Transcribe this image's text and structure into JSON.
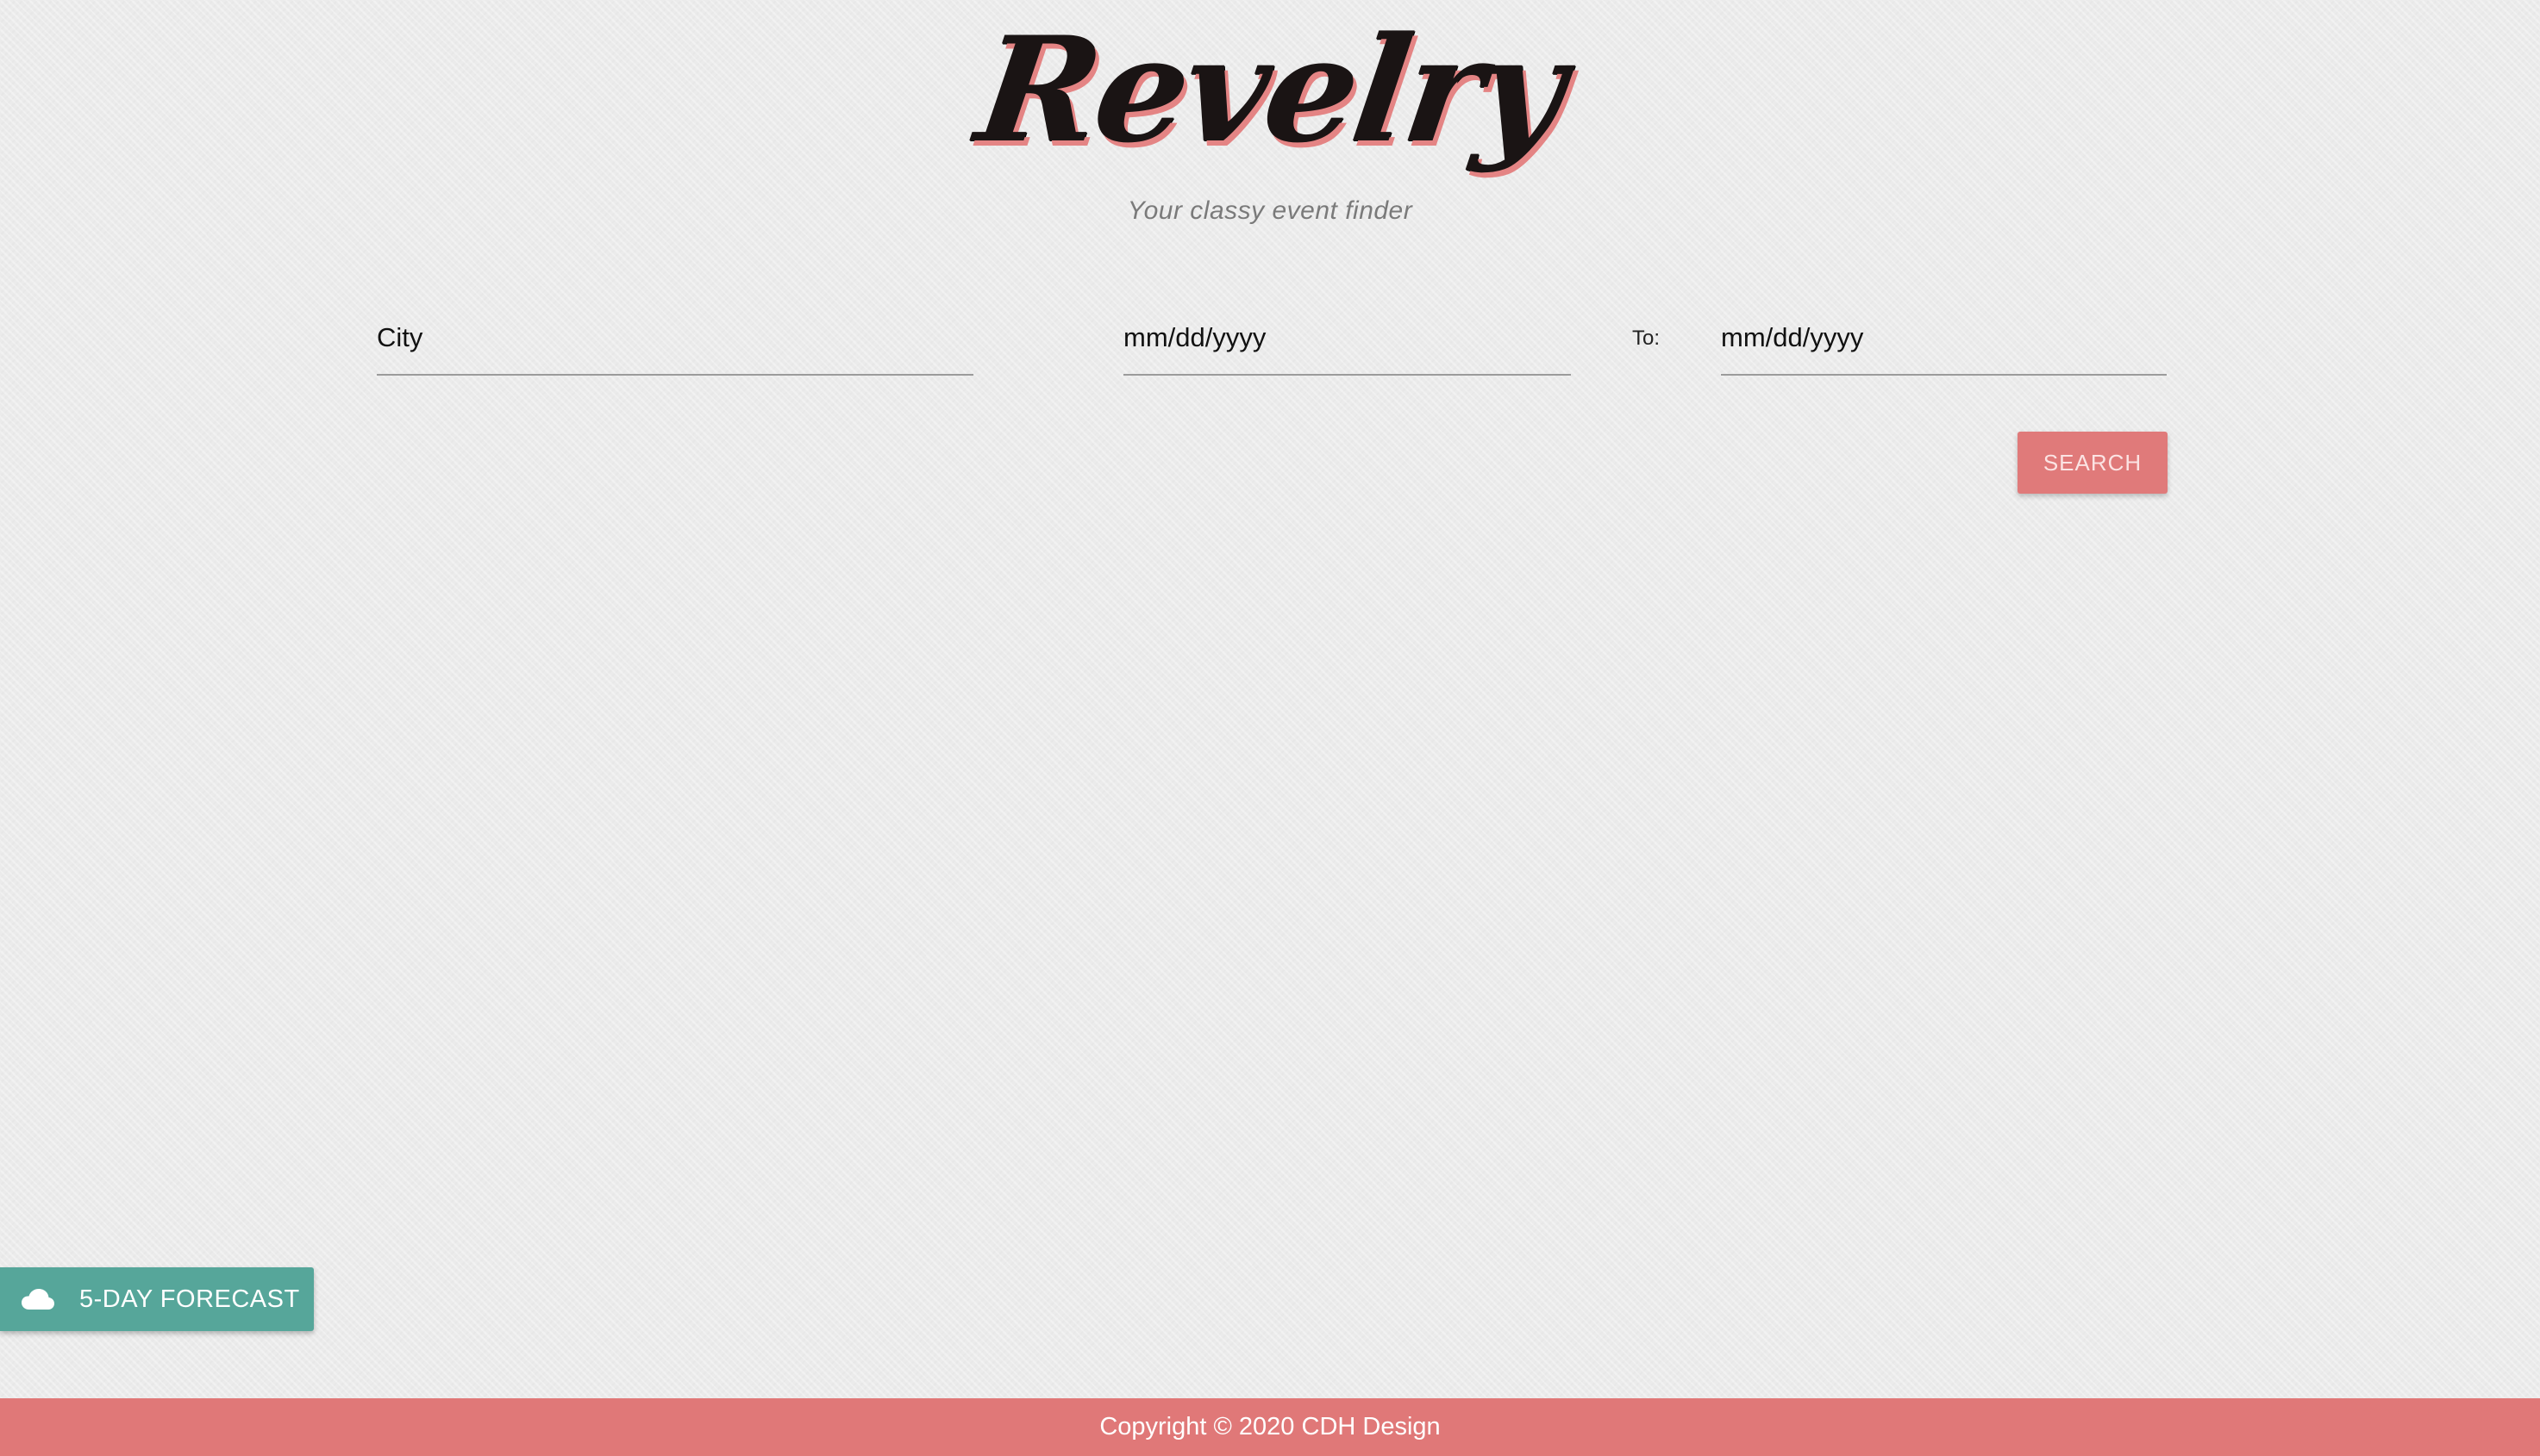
{
  "header": {
    "logo_text": "Revelry",
    "tagline": "Your classy event finder"
  },
  "search_form": {
    "city_placeholder": "City",
    "from_date_placeholder": "mm/dd/yyyy",
    "to_label": "To:",
    "to_date_placeholder": "mm/dd/yyyy",
    "search_label": "SEARCH"
  },
  "forecast": {
    "icon": "cloud-icon",
    "label": "5-DAY FORECAST"
  },
  "footer": {
    "copyright": "Copyright © 2020 CDH Design"
  },
  "colors": {
    "accent": "#e07a7a",
    "forecast": "#56a69a",
    "background": "#ebebeb"
  }
}
